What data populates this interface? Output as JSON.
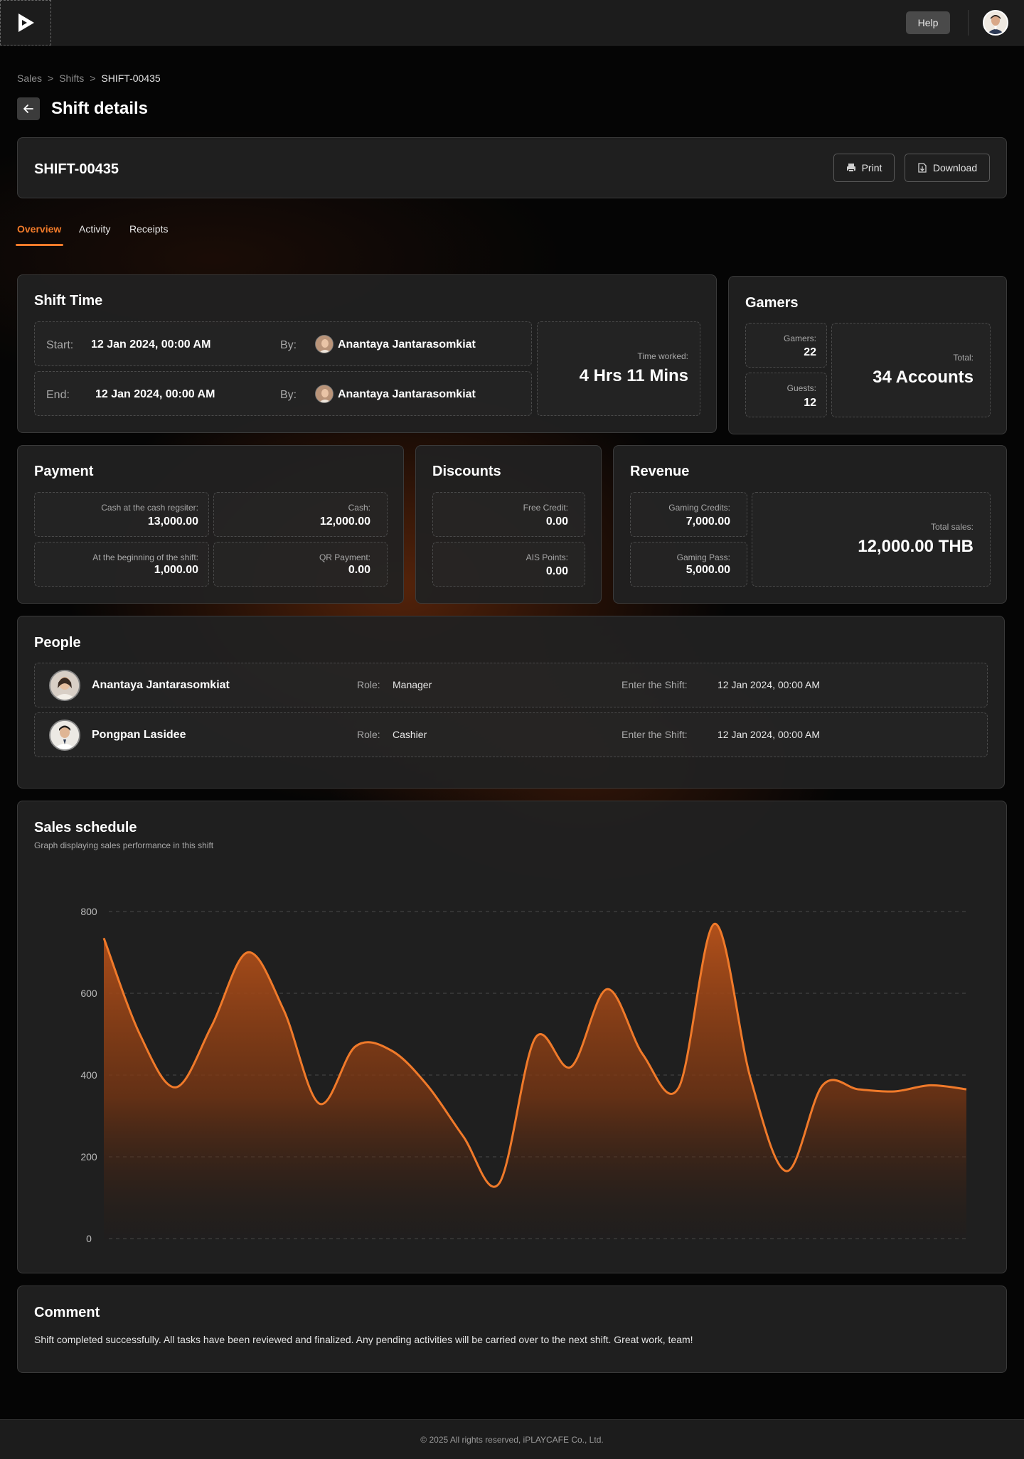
{
  "topbar": {
    "help_label": "Help"
  },
  "breadcrumb": [
    "Sales",
    "Shifts",
    "SHIFT-00435"
  ],
  "breadcrumb_sep": ">",
  "page": {
    "title": "Shift details"
  },
  "shift": {
    "id": "SHIFT-00435",
    "print_label": "Print",
    "download_label": "Download"
  },
  "tabs": [
    "Overview",
    "Activity",
    "Receipts"
  ],
  "shift_time": {
    "title": "Shift Time",
    "start_label": "Start:",
    "start_value": "12 Jan 2024, 00:00 AM",
    "end_label": "End:",
    "end_value": "12 Jan 2024, 00:00 AM",
    "by_label": "By:",
    "start_by": "Anantaya Jantarasomkiat",
    "end_by": "Anantaya Jantarasomkiat",
    "worked_label": "Time worked:",
    "worked_value": "4 Hrs 11 Mins"
  },
  "gamers": {
    "title": "Gamers",
    "gamers_label": "Gamers:",
    "gamers_value": "22",
    "guests_label": "Guests:",
    "guests_value": "12",
    "total_label": "Total:",
    "total_value": "34 Accounts"
  },
  "payment": {
    "title": "Payment",
    "cash_register_label": "Cash at the cash regsiter:",
    "cash_register_value": "13,000.00",
    "cash_label": "Cash:",
    "cash_value": "12,000.00",
    "beginning_label": "At the beginning of the shift:",
    "beginning_value": "1,000.00",
    "qr_label": "QR Payment:",
    "qr_value": "0.00"
  },
  "discounts": {
    "title": "Discounts",
    "free_credit_label": "Free Credit:",
    "free_credit_value": "0.00",
    "ais_label": "AIS Points:",
    "ais_value": "0.00"
  },
  "revenue": {
    "title": "Revenue",
    "gaming_credits_label": "Gaming Credits:",
    "gaming_credits_value": "7,000.00",
    "gaming_pass_label": "Gaming Pass:",
    "gaming_pass_value": "5,000.00",
    "total_label": "Total sales:",
    "total_value": "12,000.00 THB"
  },
  "people": {
    "title": "People",
    "role_label": "Role:",
    "enter_label": "Enter the Shift:",
    "rows": [
      {
        "name": "Anantaya Jantarasomkiat",
        "role": "Manager",
        "entered": "12 Jan 2024, 00:00 AM"
      },
      {
        "name": "Pongpan Lasidee",
        "role": "Cashier",
        "entered": "12 Jan 2024, 00:00 AM"
      }
    ]
  },
  "sales_schedule": {
    "title": "Sales schedule",
    "subtitle": "Graph displaying sales performance in this shift"
  },
  "chart_data": {
    "type": "area",
    "title": "",
    "xlabel": "",
    "ylabel": "",
    "ylim": [
      0,
      800
    ],
    "yticks": [
      0,
      200,
      400,
      600,
      800
    ],
    "grid": true,
    "series_color": "#f07a2a",
    "x": [
      0,
      1,
      2,
      3,
      4,
      5,
      6,
      7,
      8,
      9,
      10,
      11,
      12,
      13,
      14,
      15,
      16,
      17,
      18,
      19,
      20,
      21,
      22,
      23,
      24
    ],
    "series": [
      {
        "values": [
          735,
          500,
          370,
          520,
          700,
          560,
          330,
          470,
          460,
          375,
          250,
          135,
          490,
          420,
          610,
          450,
          370,
          770,
          390,
          165,
          375,
          365,
          360,
          375,
          365
        ]
      }
    ]
  },
  "comment": {
    "title": "Comment",
    "text": "Shift completed successfully. All tasks have been reviewed and finalized. Any pending activities will be carried over to the next shift. Great work, team!"
  },
  "footer": {
    "text": "© 2025 All rights reserved, iPLAYCAFE Co., Ltd."
  }
}
